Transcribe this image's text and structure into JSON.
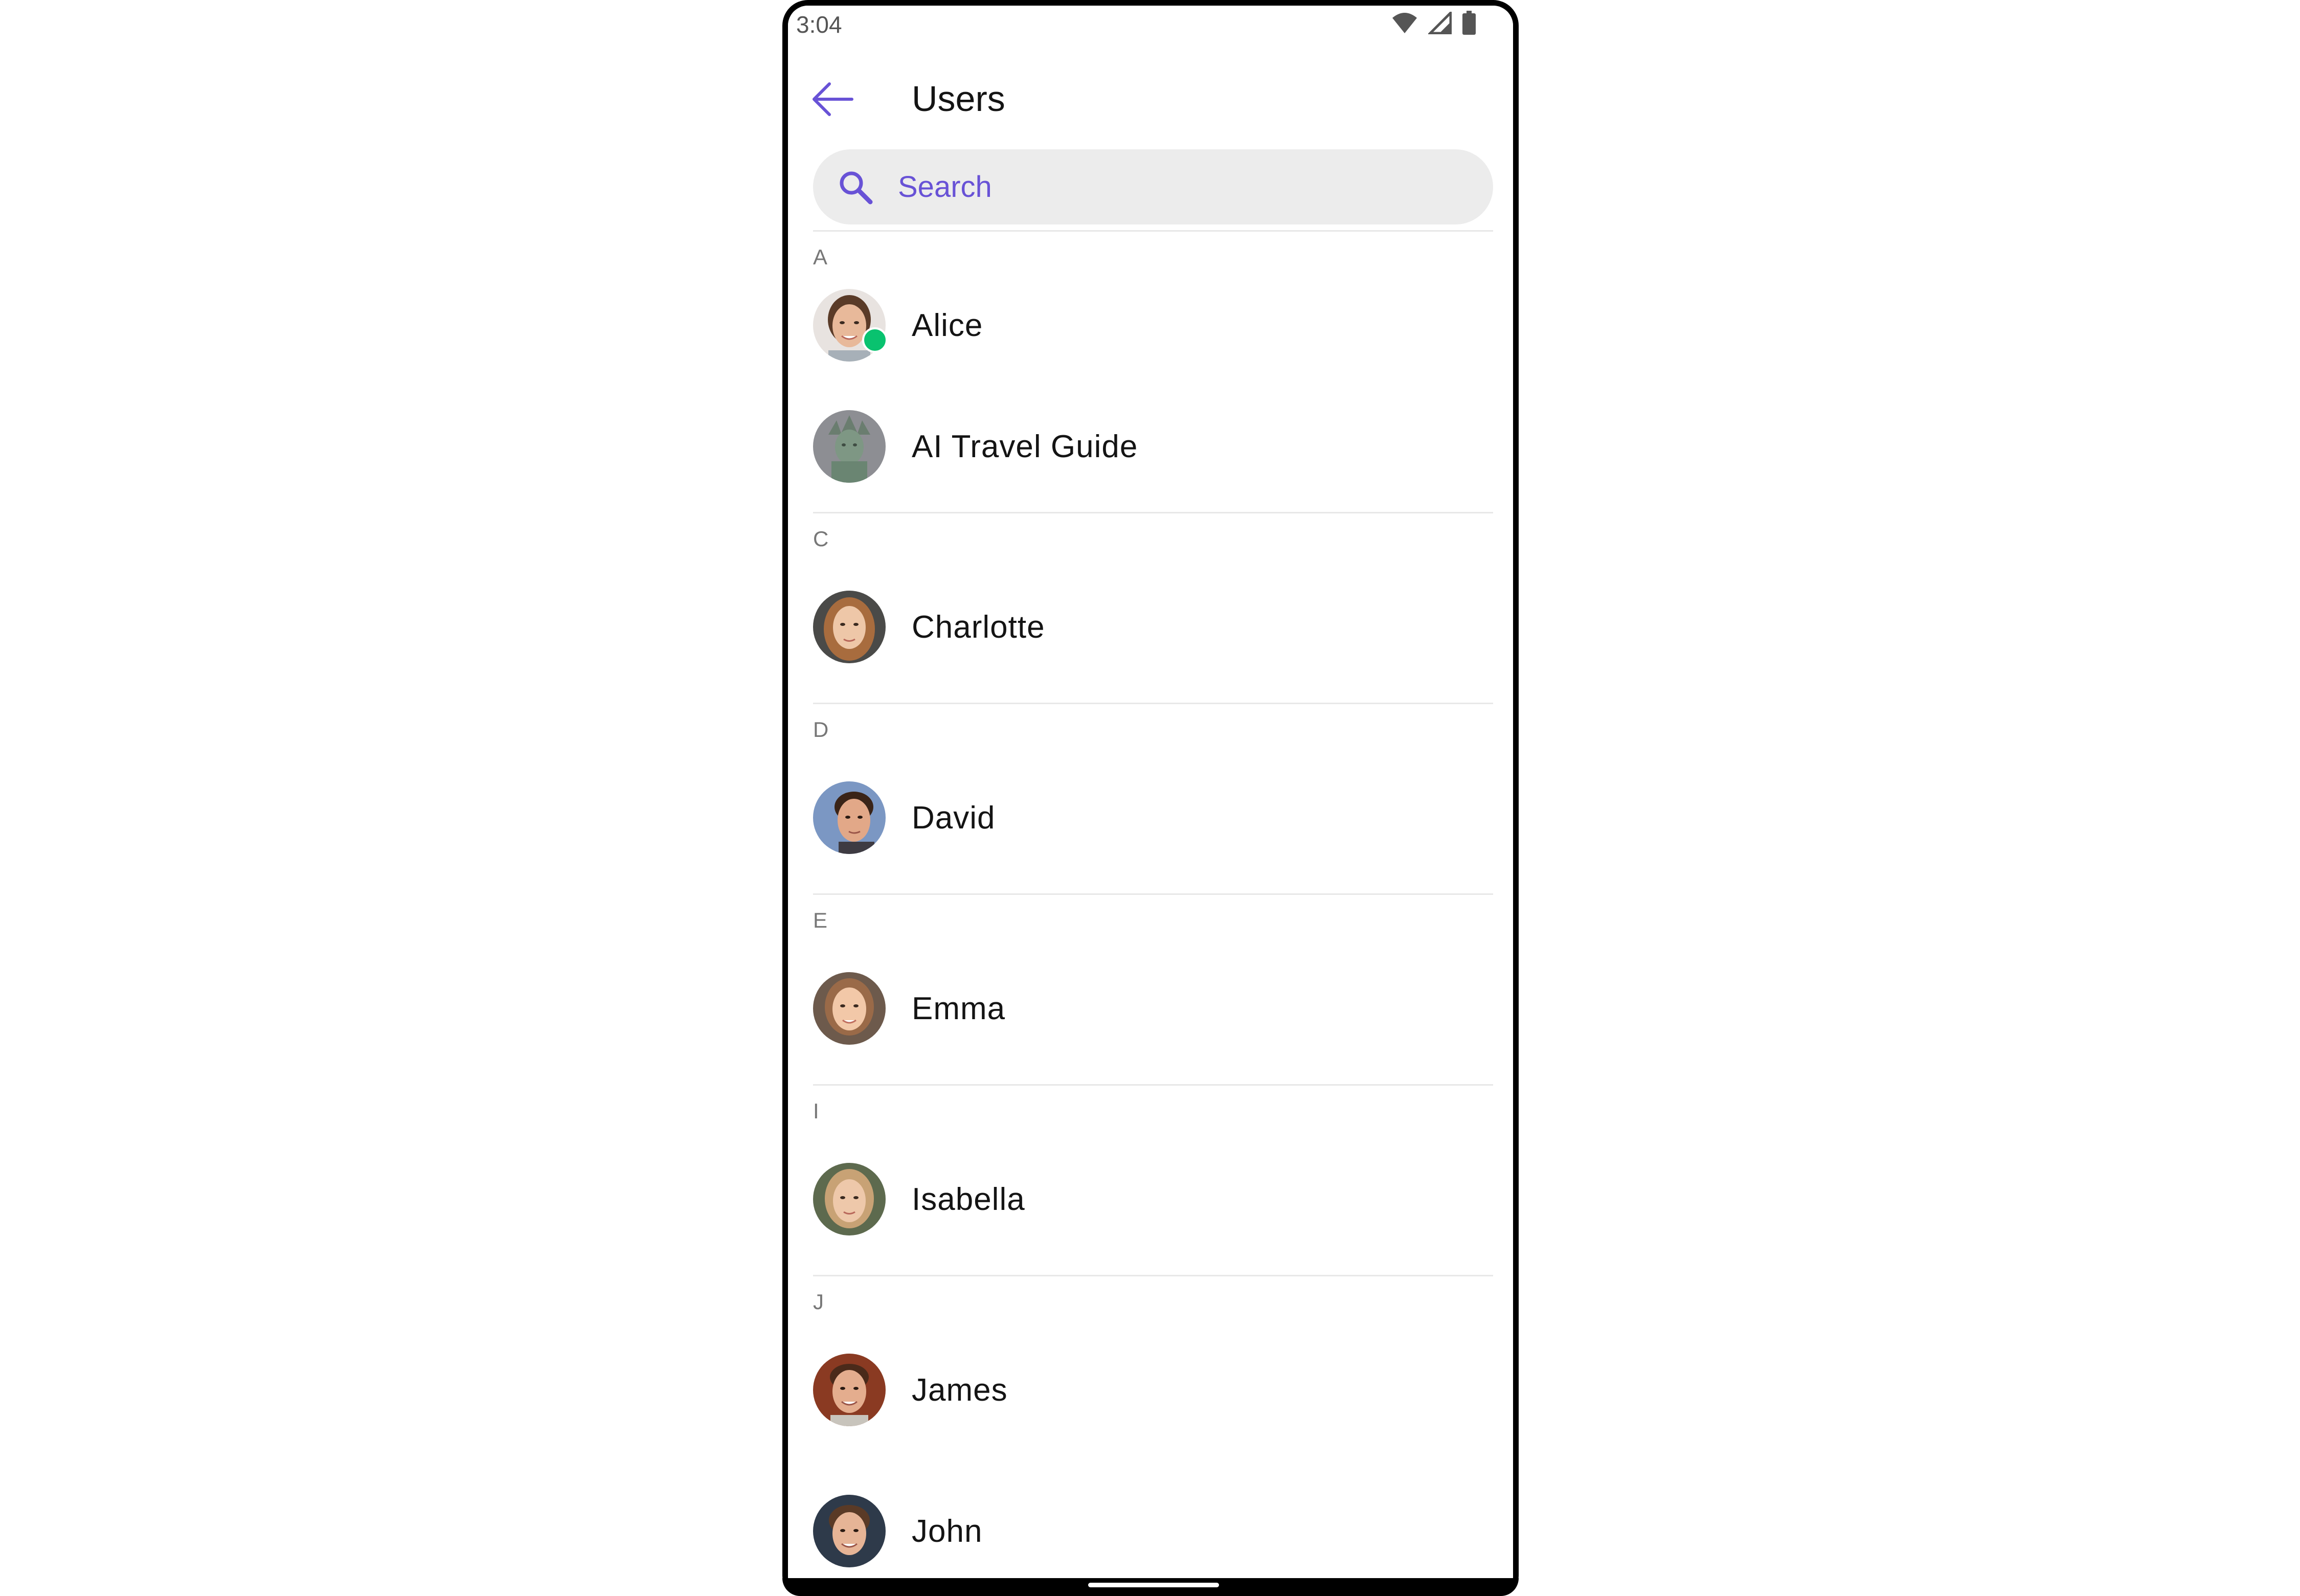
{
  "status_bar": {
    "time": "3:04",
    "icons": [
      "wifi-icon",
      "signal-icon",
      "battery-icon"
    ]
  },
  "header": {
    "back_icon": "arrow-left-icon",
    "title": "Users"
  },
  "search": {
    "icon": "search-icon",
    "placeholder": "Search"
  },
  "colors": {
    "accent": "#6852d6",
    "presence_online": "#09c26f",
    "search_bg": "#ececec",
    "divider": "#e8e8e8"
  },
  "sections": [
    {
      "letter": "A",
      "users": [
        {
          "name": "Alice",
          "online": true
        },
        {
          "name": "AI Travel Guide",
          "online": false
        }
      ]
    },
    {
      "letter": "C",
      "users": [
        {
          "name": "Charlotte",
          "online": false
        }
      ]
    },
    {
      "letter": "D",
      "users": [
        {
          "name": "David",
          "online": false
        }
      ]
    },
    {
      "letter": "E",
      "users": [
        {
          "name": "Emma",
          "online": false
        }
      ]
    },
    {
      "letter": "I",
      "users": [
        {
          "name": "Isabella",
          "online": false
        }
      ]
    },
    {
      "letter": "J",
      "users": [
        {
          "name": "James",
          "online": false
        },
        {
          "name": "John",
          "online": false
        }
      ]
    }
  ]
}
